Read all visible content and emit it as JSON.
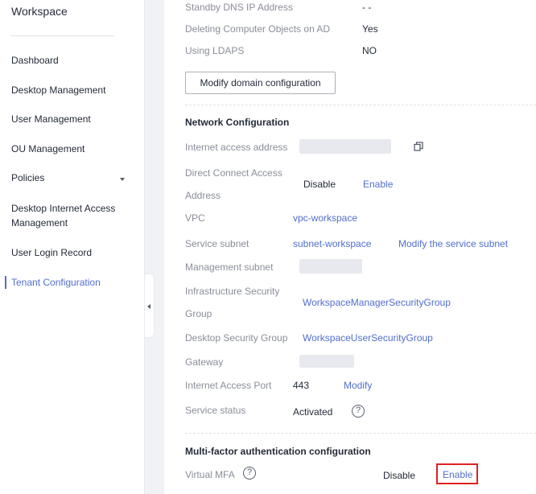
{
  "sidebar": {
    "title": "Workspace",
    "items": [
      {
        "label": "Dashboard"
      },
      {
        "label": "Desktop Management"
      },
      {
        "label": "User Management"
      },
      {
        "label": "OU Management"
      },
      {
        "label": "Policies"
      },
      {
        "label": "Desktop Internet Access Management"
      },
      {
        "label": "User Login Record"
      },
      {
        "label": "Tenant Configuration"
      }
    ],
    "active_item": "Tenant Configuration"
  },
  "domain": {
    "standby_dns_label": "Standby DNS IP Address",
    "standby_dns_value": "- -",
    "deleting_objects_label": "Deleting Computer Objects on AD",
    "deleting_objects_value": "Yes",
    "ldaps_label": "Using LDAPS",
    "ldaps_value": "NO",
    "modify_button": "Modify domain configuration"
  },
  "network": {
    "title": "Network Configuration",
    "internet_access_address_label": "Internet access address",
    "direct_connect_label_1": "Direct Connect Access",
    "direct_connect_label_2": "Address",
    "direct_connect_value": "Disable",
    "direct_connect_action": "Enable",
    "vpc_label": "VPC",
    "vpc_value": "vpc-workspace",
    "service_subnet_label": "Service subnet",
    "service_subnet_value": "subnet-workspace",
    "service_subnet_action": "Modify the service subnet",
    "management_subnet_label": "Management subnet",
    "infra_sg_label_1": "Infrastructure Security",
    "infra_sg_label_2": "Group",
    "infra_sg_value": "WorkspaceManagerSecurityGroup",
    "desktop_sg_label": "Desktop Security Group",
    "desktop_sg_value": "WorkspaceUserSecurityGroup",
    "gateway_label": "Gateway",
    "internet_port_label": "Internet Access Port",
    "internet_port_value": "443",
    "internet_port_action": "Modify",
    "service_status_label": "Service status",
    "service_status_value": "Activated",
    "help_glyph": "?"
  },
  "mfa": {
    "title": "Multi-factor authentication configuration",
    "virtual_mfa_label": "Virtual MFA",
    "virtual_mfa_value": "Disable",
    "virtual_mfa_action": "Enable",
    "help_glyph": "?"
  },
  "colors": {
    "link": "#526ecc",
    "label": "#8a8e99",
    "text": "#252b3a",
    "highlight": "#e02020"
  },
  "icons": [
    "copy-icon",
    "help-icon",
    "chevron-down-icon",
    "chevron-left-icon"
  ]
}
